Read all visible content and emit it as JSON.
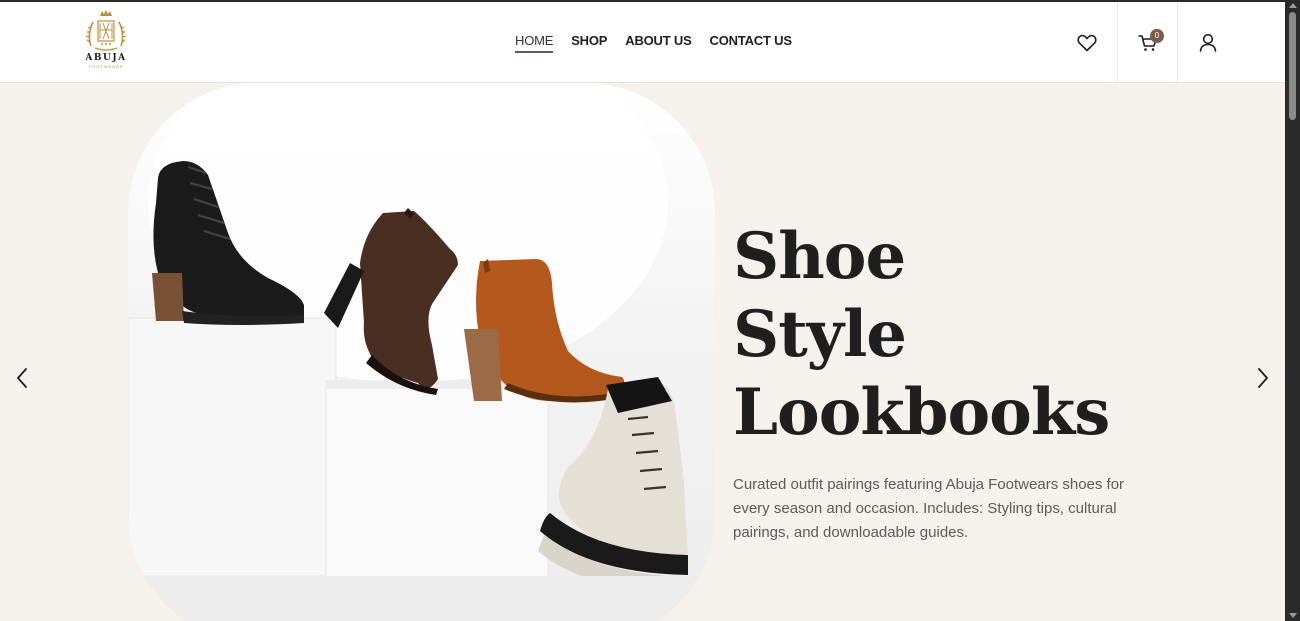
{
  "brand": {
    "name": "ABUJA",
    "tagline": "FOOTWEARS",
    "accent_color": "#b8933e"
  },
  "nav": {
    "items": [
      {
        "label": "HOME",
        "active": true
      },
      {
        "label": "SHOP",
        "active": false
      },
      {
        "label": "ABOUT US",
        "active": false
      },
      {
        "label": "CONTACT US",
        "active": false
      }
    ]
  },
  "header_icons": {
    "wishlist": "heart-icon",
    "cart": "cart-icon",
    "cart_count": "0",
    "account": "user-icon"
  },
  "hero": {
    "title_lines": [
      "Shoe",
      "Style",
      "Lookbooks"
    ],
    "description": "Curated outfit pairings featuring Abuja Footwears shoes for every season and occasion. Includes: Styling tips, cultural pairings, and downloadable guides.",
    "prev_icon": "chevron-left-icon",
    "next_icon": "chevron-right-icon",
    "background_color": "#f5f1ec"
  }
}
